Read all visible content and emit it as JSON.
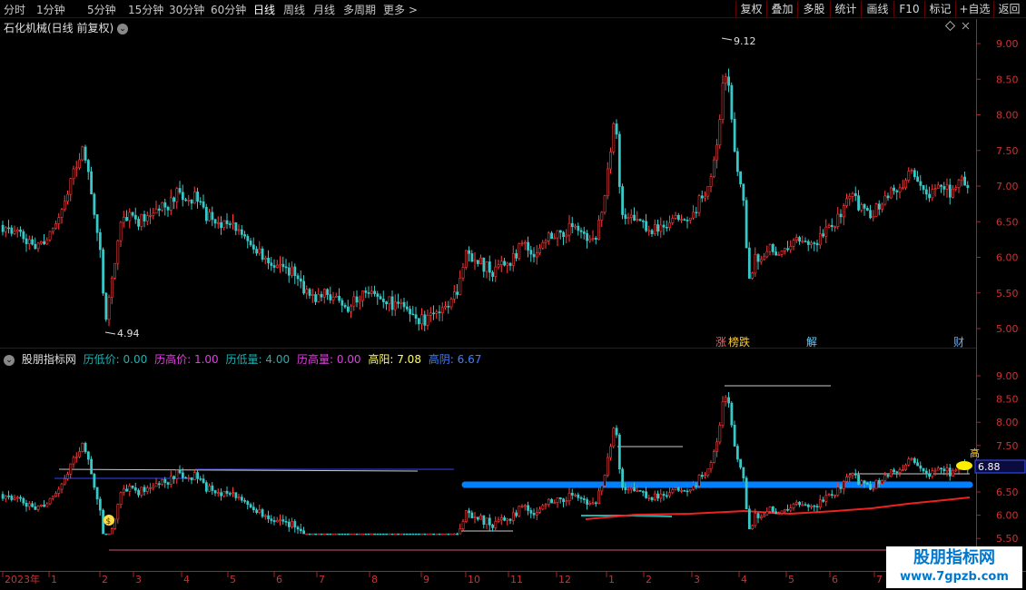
{
  "toolbar": {
    "periods": [
      "分时",
      "1分钟",
      "5分钟",
      "15分钟",
      "30分钟",
      "60分钟",
      "日线",
      "周线",
      "月线",
      "多周期",
      "更多 >"
    ],
    "active_period": "日线",
    "right_buttons": [
      "复权",
      "叠加",
      "多股",
      "统计",
      "画线",
      "F10",
      "标记",
      "+自选",
      "返回"
    ]
  },
  "main_chart": {
    "title": "石化机械(日线 前复权)",
    "high_label": "9.12",
    "low_label": "4.94",
    "y_ticks": [
      "9.00",
      "8.50",
      "8.00",
      "7.50",
      "7.00",
      "6.50",
      "6.00",
      "5.50",
      "5.00"
    ],
    "event_tags": [
      "涨",
      "榜跌",
      "解",
      "财"
    ]
  },
  "indicator": {
    "name": "股朋指标网",
    "fields": [
      {
        "label": "历低价:",
        "value": "0.00",
        "color": "#1fb0b0"
      },
      {
        "label": "历高价:",
        "value": "1.00",
        "color": "#e040e0"
      },
      {
        "label": "历低量:",
        "value": "4.00",
        "color": "#1fb0b0"
      },
      {
        "label": "历高量:",
        "value": "0.00",
        "color": "#e040e0"
      },
      {
        "label": "高阳:",
        "value": "7.08",
        "color": "#ffff66"
      },
      {
        "label": "高阴:",
        "value": "6.67",
        "color": "#4080ff"
      }
    ],
    "y_ticks": [
      "9.00",
      "8.50",
      "8.00",
      "7.50",
      "7.00",
      "6.50",
      "6.00",
      "5.50"
    ],
    "current_value": "6.88",
    "side_char": "高"
  },
  "date_axis": {
    "labels": [
      "2023年",
      "1",
      "2",
      "3",
      "4",
      "5",
      "6",
      "7",
      "8",
      "9",
      "10",
      "11",
      "12",
      "1",
      "2",
      "3",
      "4",
      "5",
      "6",
      "7"
    ]
  },
  "watermark": {
    "line1": "股朋指标网",
    "line2": "www.7gpzb.com"
  },
  "colors": {
    "up": "#ff3c3c",
    "down": "#38c8c8",
    "axis": "#cc3333",
    "accent_blue": "#0080ff"
  },
  "chart_data": {
    "type": "candlestick",
    "title": "石化机械(日线 前复权)",
    "ylim": [
      4.9,
      9.3
    ],
    "x": [
      "2023-01",
      "2023-02",
      "2023-03",
      "2023-04",
      "2023-05",
      "2023-06",
      "2023-07",
      "2023-08",
      "2023-09",
      "2023-10",
      "2023-11",
      "2023-12",
      "2024-01",
      "2024-02",
      "2024-03",
      "2024-04",
      "2024-05",
      "2024-06",
      "2024-07"
    ],
    "close_series": [
      6.3,
      6.8,
      6.6,
      6.8,
      6.4,
      5.9,
      5.5,
      5.3,
      5.1,
      6.0,
      6.2,
      6.5,
      6.6,
      6.6,
      7.2,
      6.0,
      6.3,
      6.8,
      6.9
    ],
    "annotations": [
      {
        "text": "9.12",
        "value": 9.12
      },
      {
        "text": "4.94",
        "value": 4.94
      }
    ]
  }
}
